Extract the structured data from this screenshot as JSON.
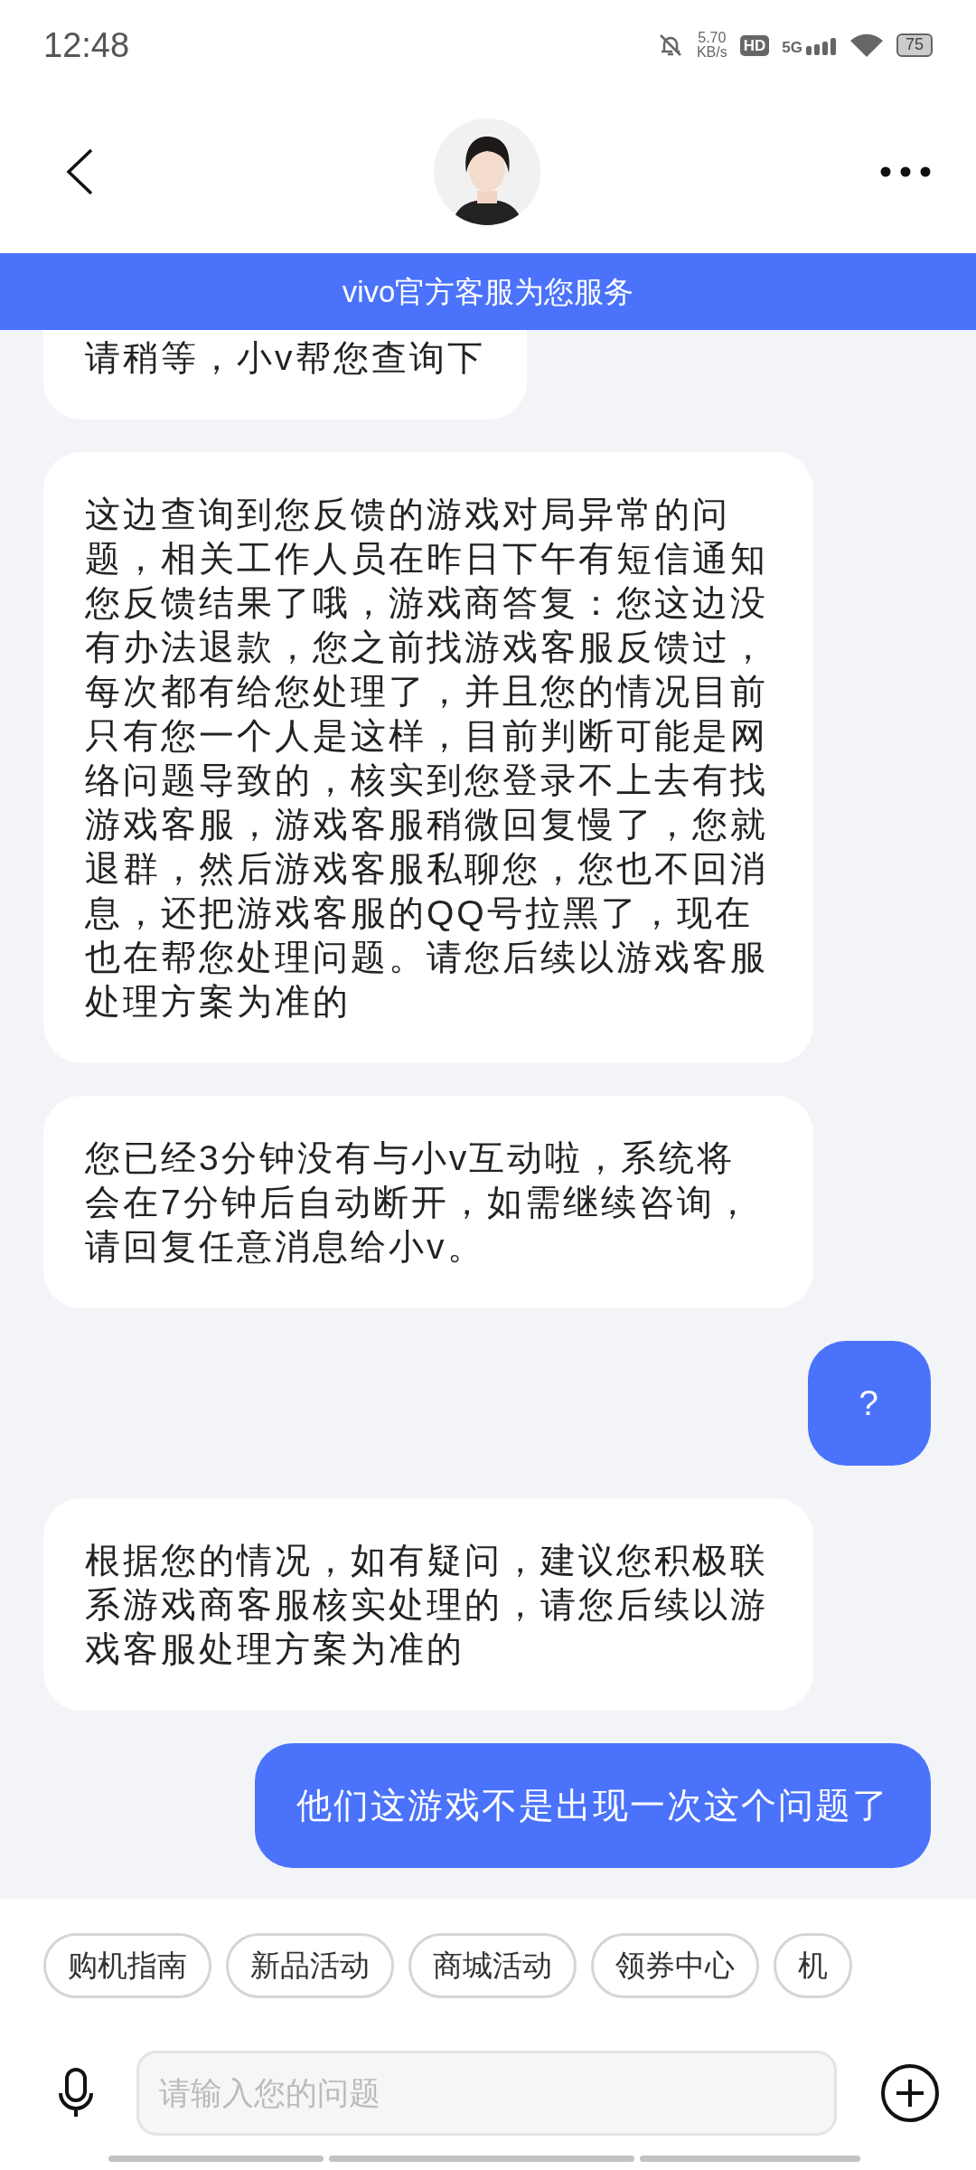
{
  "status_bar": {
    "time": "12:48",
    "speed_value": "5.70",
    "speed_unit": "KB/s",
    "hd": "HD",
    "network": "5G",
    "battery": "75"
  },
  "header": {
    "banner": "vivo官方客服为您服务"
  },
  "messages": [
    {
      "kind": "agent",
      "text": "请稍等，小v帮您查询下"
    },
    {
      "kind": "agent",
      "text": "这边查询到您反馈的游戏对局异常的问题，相关工作人员在昨日下午有短信通知您反馈结果了哦，游戏商答复：您这边没有办法退款，您之前找游戏客服反馈过，每次都有给您处理了，并且您的情况目前只有您一个人是这样，目前判断可能是网络问题导致的，核实到您登录不上去有找游戏客服，游戏客服稍微回复慢了，您就退群，然后游戏客服私聊您，您也不回消息，还把游戏客服的QQ号拉黑了，现在也在帮您处理问题。请您后续以游戏客服处理方案为准的"
    },
    {
      "kind": "agent",
      "text": "您已经3分钟没有与小v互动啦，系统将会在7分钟后自动断开，如需继续咨询，请回复任意消息给小v。"
    },
    {
      "kind": "user",
      "text": "?"
    },
    {
      "kind": "agent",
      "text": "根据您的情况，如有疑问，建议您积极联系游戏商客服核实处理的，请您后续以游戏客服处理方案为准的"
    },
    {
      "kind": "user",
      "text": "他们这游戏不是出现一次这个问题了"
    }
  ],
  "quick_replies": [
    "购机指南",
    "新品活动",
    "商城活动",
    "领券中心",
    "机"
  ],
  "input": {
    "placeholder": "请输入您的问题"
  }
}
